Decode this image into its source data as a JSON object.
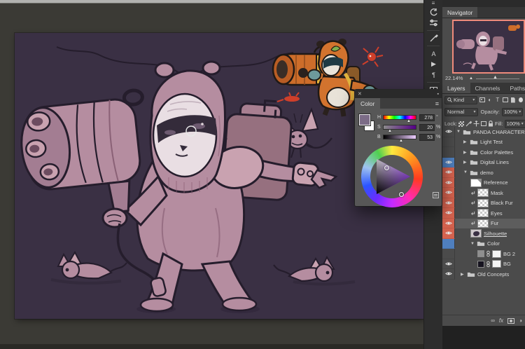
{
  "navigator": {
    "tab": "Navigator",
    "zoom_value": "22.14%"
  },
  "panel_tabs": {
    "layers": "Layers",
    "channels": "Channels",
    "paths": "Paths"
  },
  "layers_panel": {
    "filter_kind": "Kind",
    "blend_mode": "Normal",
    "opacity_label": "Opacity:",
    "opacity_value": "100%",
    "lock_label": "Lock:",
    "fill_label": "Fill:",
    "fill_value": "100%",
    "footer": {
      "fx_label": "fx"
    },
    "items": [
      {
        "name": "PANDA CHARACTER",
        "kind": "group",
        "expanded": true,
        "visible": true,
        "color_label": null,
        "indent": 0
      },
      {
        "name": "Light Test",
        "kind": "group",
        "expanded": false,
        "visible": false,
        "color_label": null,
        "indent": 1
      },
      {
        "name": "Color Palettes",
        "kind": "group",
        "expanded": false,
        "visible": false,
        "color_label": null,
        "indent": 1
      },
      {
        "name": "Digital Lines",
        "kind": "group",
        "expanded": false,
        "visible": true,
        "color_label": "blue",
        "indent": 1
      },
      {
        "name": "demo",
        "kind": "group",
        "expanded": true,
        "visible": true,
        "color_label": "red",
        "indent": 1
      },
      {
        "name": "Reference",
        "kind": "layer",
        "visible": true,
        "color_label": "red",
        "indent": 2,
        "thumb": "image",
        "clipped": false
      },
      {
        "name": "Mask",
        "kind": "layer",
        "visible": true,
        "color_label": "red",
        "indent": 2,
        "thumb": "checker",
        "clipped": true
      },
      {
        "name": "Black Fur",
        "kind": "layer",
        "visible": true,
        "color_label": "red",
        "indent": 2,
        "thumb": "checker",
        "clipped": true
      },
      {
        "name": "Eyes",
        "kind": "layer",
        "visible": true,
        "color_label": "red",
        "indent": 2,
        "thumb": "checker",
        "clipped": true
      },
      {
        "name": "Fur",
        "kind": "layer",
        "visible": true,
        "color_label": "red",
        "indent": 2,
        "thumb": "checker",
        "clipped": true,
        "selected": true
      },
      {
        "name": "Silhouette",
        "kind": "layer",
        "visible": true,
        "color_label": "red",
        "indent": 2,
        "thumb": "art",
        "active": true
      },
      {
        "name": "Color",
        "kind": "group",
        "expanded": true,
        "visible": false,
        "color_label": "blue",
        "indent": 2
      },
      {
        "name": "BG 2",
        "kind": "fill",
        "visible": false,
        "indent": 3,
        "swatch_color": "#8f8f8f"
      },
      {
        "name": "BG",
        "kind": "fill",
        "visible": true,
        "indent": 3,
        "swatch_color": "#16131f"
      },
      {
        "name": "Old Concepts",
        "kind": "group",
        "expanded": false,
        "visible": true,
        "color_label": null,
        "indent": 1
      }
    ]
  },
  "color_panel": {
    "tab": "Color",
    "close_glyph": "✕",
    "menu_glyph": "≡",
    "sliders": [
      {
        "label": "H",
        "value": "278",
        "unit": "°"
      },
      {
        "label": "S",
        "value": "20",
        "unit": "%"
      },
      {
        "label": "B",
        "value": "53",
        "unit": "%"
      }
    ],
    "foreground_color": "#7c6c87",
    "background_color": "#ffffff"
  },
  "tool_strip_glyphs": {
    "menu": "≡",
    "character": "A",
    "actions": "▶",
    "paragraph": "¶"
  },
  "colors": {
    "workspace_bg": "#3b3a35",
    "canvas_bg": "#3a3044",
    "character_main": "#b58da0",
    "character_shadow": "#8a6176",
    "character_light": "#c9a2b0",
    "character_outline": "#251d2c",
    "face_white": "#e9dee3",
    "eye_band": "#342b3a",
    "reference_orange": "#d2732e",
    "reference_teal": "#6d9a9b",
    "reference_yellow": "#e0b13c",
    "reference_red_critter": "#cf3f2a",
    "layer_label_red": "#d4624e",
    "layer_label_blue": "#4f7fbe",
    "navigator_proxy_border": "#ee8a7b",
    "panel_bg": "#4b4b4b",
    "floating_panel_bg": "#575757"
  }
}
